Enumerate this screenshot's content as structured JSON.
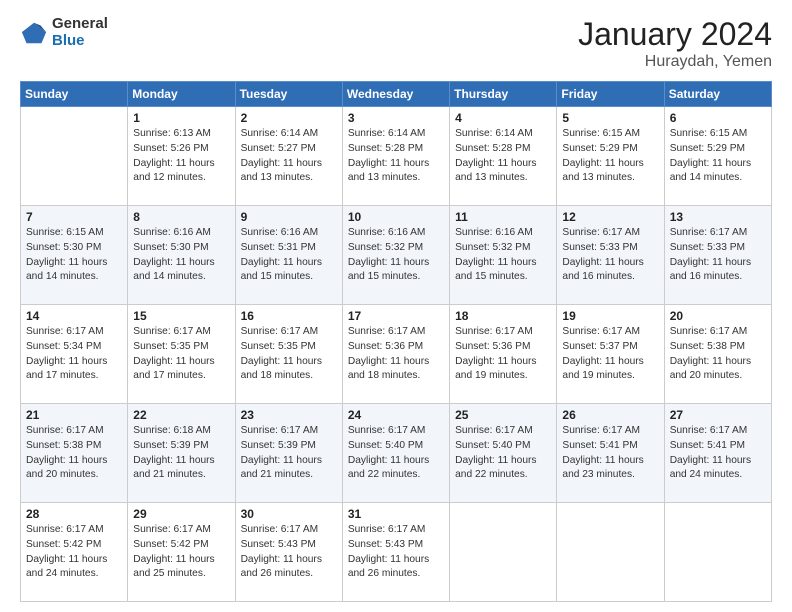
{
  "logo": {
    "general": "General",
    "blue": "Blue"
  },
  "header": {
    "month": "January 2024",
    "location": "Huraydah, Yemen"
  },
  "weekdays": [
    "Sunday",
    "Monday",
    "Tuesday",
    "Wednesday",
    "Thursday",
    "Friday",
    "Saturday"
  ],
  "weeks": [
    [
      {
        "day": "",
        "sunrise": "",
        "sunset": "",
        "daylight": ""
      },
      {
        "day": "1",
        "sunrise": "Sunrise: 6:13 AM",
        "sunset": "Sunset: 5:26 PM",
        "daylight": "Daylight: 11 hours and 12 minutes."
      },
      {
        "day": "2",
        "sunrise": "Sunrise: 6:14 AM",
        "sunset": "Sunset: 5:27 PM",
        "daylight": "Daylight: 11 hours and 13 minutes."
      },
      {
        "day": "3",
        "sunrise": "Sunrise: 6:14 AM",
        "sunset": "Sunset: 5:28 PM",
        "daylight": "Daylight: 11 hours and 13 minutes."
      },
      {
        "day": "4",
        "sunrise": "Sunrise: 6:14 AM",
        "sunset": "Sunset: 5:28 PM",
        "daylight": "Daylight: 11 hours and 13 minutes."
      },
      {
        "day": "5",
        "sunrise": "Sunrise: 6:15 AM",
        "sunset": "Sunset: 5:29 PM",
        "daylight": "Daylight: 11 hours and 13 minutes."
      },
      {
        "day": "6",
        "sunrise": "Sunrise: 6:15 AM",
        "sunset": "Sunset: 5:29 PM",
        "daylight": "Daylight: 11 hours and 14 minutes."
      }
    ],
    [
      {
        "day": "7",
        "sunrise": "Sunrise: 6:15 AM",
        "sunset": "Sunset: 5:30 PM",
        "daylight": "Daylight: 11 hours and 14 minutes."
      },
      {
        "day": "8",
        "sunrise": "Sunrise: 6:16 AM",
        "sunset": "Sunset: 5:30 PM",
        "daylight": "Daylight: 11 hours and 14 minutes."
      },
      {
        "day": "9",
        "sunrise": "Sunrise: 6:16 AM",
        "sunset": "Sunset: 5:31 PM",
        "daylight": "Daylight: 11 hours and 15 minutes."
      },
      {
        "day": "10",
        "sunrise": "Sunrise: 6:16 AM",
        "sunset": "Sunset: 5:32 PM",
        "daylight": "Daylight: 11 hours and 15 minutes."
      },
      {
        "day": "11",
        "sunrise": "Sunrise: 6:16 AM",
        "sunset": "Sunset: 5:32 PM",
        "daylight": "Daylight: 11 hours and 15 minutes."
      },
      {
        "day": "12",
        "sunrise": "Sunrise: 6:17 AM",
        "sunset": "Sunset: 5:33 PM",
        "daylight": "Daylight: 11 hours and 16 minutes."
      },
      {
        "day": "13",
        "sunrise": "Sunrise: 6:17 AM",
        "sunset": "Sunset: 5:33 PM",
        "daylight": "Daylight: 11 hours and 16 minutes."
      }
    ],
    [
      {
        "day": "14",
        "sunrise": "Sunrise: 6:17 AM",
        "sunset": "Sunset: 5:34 PM",
        "daylight": "Daylight: 11 hours and 17 minutes."
      },
      {
        "day": "15",
        "sunrise": "Sunrise: 6:17 AM",
        "sunset": "Sunset: 5:35 PM",
        "daylight": "Daylight: 11 hours and 17 minutes."
      },
      {
        "day": "16",
        "sunrise": "Sunrise: 6:17 AM",
        "sunset": "Sunset: 5:35 PM",
        "daylight": "Daylight: 11 hours and 18 minutes."
      },
      {
        "day": "17",
        "sunrise": "Sunrise: 6:17 AM",
        "sunset": "Sunset: 5:36 PM",
        "daylight": "Daylight: 11 hours and 18 minutes."
      },
      {
        "day": "18",
        "sunrise": "Sunrise: 6:17 AM",
        "sunset": "Sunset: 5:36 PM",
        "daylight": "Daylight: 11 hours and 19 minutes."
      },
      {
        "day": "19",
        "sunrise": "Sunrise: 6:17 AM",
        "sunset": "Sunset: 5:37 PM",
        "daylight": "Daylight: 11 hours and 19 minutes."
      },
      {
        "day": "20",
        "sunrise": "Sunrise: 6:17 AM",
        "sunset": "Sunset: 5:38 PM",
        "daylight": "Daylight: 11 hours and 20 minutes."
      }
    ],
    [
      {
        "day": "21",
        "sunrise": "Sunrise: 6:17 AM",
        "sunset": "Sunset: 5:38 PM",
        "daylight": "Daylight: 11 hours and 20 minutes."
      },
      {
        "day": "22",
        "sunrise": "Sunrise: 6:18 AM",
        "sunset": "Sunset: 5:39 PM",
        "daylight": "Daylight: 11 hours and 21 minutes."
      },
      {
        "day": "23",
        "sunrise": "Sunrise: 6:17 AM",
        "sunset": "Sunset: 5:39 PM",
        "daylight": "Daylight: 11 hours and 21 minutes."
      },
      {
        "day": "24",
        "sunrise": "Sunrise: 6:17 AM",
        "sunset": "Sunset: 5:40 PM",
        "daylight": "Daylight: 11 hours and 22 minutes."
      },
      {
        "day": "25",
        "sunrise": "Sunrise: 6:17 AM",
        "sunset": "Sunset: 5:40 PM",
        "daylight": "Daylight: 11 hours and 22 minutes."
      },
      {
        "day": "26",
        "sunrise": "Sunrise: 6:17 AM",
        "sunset": "Sunset: 5:41 PM",
        "daylight": "Daylight: 11 hours and 23 minutes."
      },
      {
        "day": "27",
        "sunrise": "Sunrise: 6:17 AM",
        "sunset": "Sunset: 5:41 PM",
        "daylight": "Daylight: 11 hours and 24 minutes."
      }
    ],
    [
      {
        "day": "28",
        "sunrise": "Sunrise: 6:17 AM",
        "sunset": "Sunset: 5:42 PM",
        "daylight": "Daylight: 11 hours and 24 minutes."
      },
      {
        "day": "29",
        "sunrise": "Sunrise: 6:17 AM",
        "sunset": "Sunset: 5:42 PM",
        "daylight": "Daylight: 11 hours and 25 minutes."
      },
      {
        "day": "30",
        "sunrise": "Sunrise: 6:17 AM",
        "sunset": "Sunset: 5:43 PM",
        "daylight": "Daylight: 11 hours and 26 minutes."
      },
      {
        "day": "31",
        "sunrise": "Sunrise: 6:17 AM",
        "sunset": "Sunset: 5:43 PM",
        "daylight": "Daylight: 11 hours and 26 minutes."
      },
      {
        "day": "",
        "sunrise": "",
        "sunset": "",
        "daylight": ""
      },
      {
        "day": "",
        "sunrise": "",
        "sunset": "",
        "daylight": ""
      },
      {
        "day": "",
        "sunrise": "",
        "sunset": "",
        "daylight": ""
      }
    ]
  ]
}
